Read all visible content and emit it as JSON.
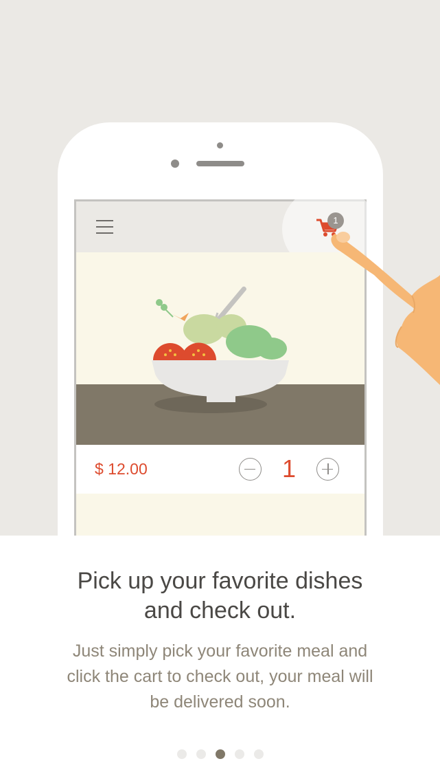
{
  "colors": {
    "background": "#ebe9e5",
    "accent_red": "#dd4b2e",
    "table_brown": "#807868",
    "food_bg": "#faf7e8",
    "text_dark": "#4a4845",
    "text_muted": "#8e8678"
  },
  "app": {
    "menu_icon": "hamburger-menu-icon",
    "cart_icon": "shopping-cart-icon",
    "cart_badge": "1"
  },
  "product": {
    "price": "$ 12.00",
    "quantity": "1",
    "decrement_icon": "minus-circle-icon",
    "increment_icon": "plus-circle-icon"
  },
  "onboarding": {
    "title_line1": "Pick up your favorite dishes",
    "title_line2": "and check out.",
    "description_line1": "Just simply pick your favorite meal and",
    "description_line2": "click the cart to check out, your meal will",
    "description_line3": "be delivered soon.",
    "pages_total": 5,
    "current_page": 3
  }
}
